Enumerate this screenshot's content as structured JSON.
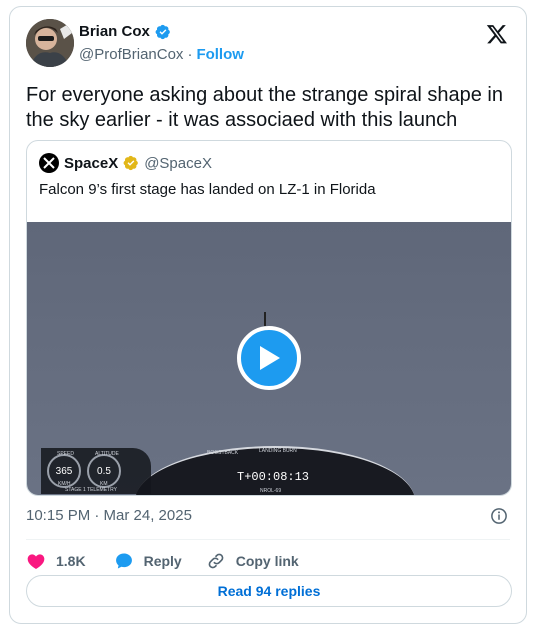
{
  "author": {
    "display_name": "Brian Cox",
    "handle": "@ProfBrianCox",
    "separator": "·",
    "follow_label": "Follow"
  },
  "tweet": {
    "text": "For everyone asking about the strange spiral shape in the sky earlier - it was associaed with this launch",
    "timestamp": "10:15 PM · Mar 24, 2025"
  },
  "quoted": {
    "display_name": "SpaceX",
    "handle": "@SpaceX",
    "text": "Falcon 9’s first stage has landed on LZ-1 in Florida",
    "video": {
      "gauge_left_value": "365",
      "gauge_left_label": "SPEED",
      "gauge_left_unit": "KM/H",
      "gauge_right_value": "0.5",
      "gauge_right_label": "ALTITUDE",
      "gauge_right_unit": "KM",
      "stage_label": "STAGE 1 TELEMETRY",
      "clock": "T+00:08:13",
      "clock_sub": "NROL-69",
      "arc_label_left": "BOOSTBACK",
      "arc_label_right": "LANDING BURN"
    }
  },
  "actions": {
    "likes": "1.8K",
    "reply_label": "Reply",
    "copy_label": "Copy link"
  },
  "read_replies_label": "Read 94 replies",
  "colors": {
    "accent": "#1d9bf0",
    "like": "#f91880",
    "muted": "#536471",
    "link": "#006fd6"
  },
  "icons": {
    "verified": "verified-badge-icon",
    "gold_verified": "gold-verified-badge-icon",
    "x_logo": "x-logo-icon",
    "play": "play-icon",
    "info": "info-icon",
    "heart": "heart-icon",
    "reply": "reply-bubble-icon",
    "link": "link-icon"
  }
}
